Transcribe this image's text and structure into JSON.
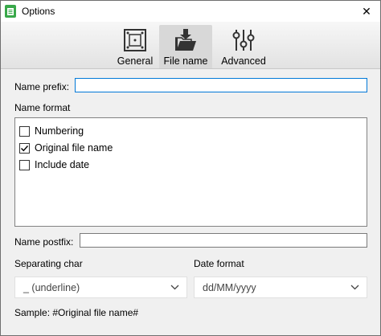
{
  "window": {
    "title": "Options",
    "close_glyph": "✕"
  },
  "tabs": [
    {
      "label": "General",
      "icon": "panel-icon",
      "active": false
    },
    {
      "label": "File name",
      "icon": "folder-download-icon",
      "active": true
    },
    {
      "label": "Advanced",
      "icon": "sliders-icon",
      "active": false
    }
  ],
  "name_prefix": {
    "label": "Name prefix:",
    "value": ""
  },
  "name_format": {
    "label": "Name format",
    "items": [
      {
        "label": "Numbering",
        "checked": false
      },
      {
        "label": "Original file name",
        "checked": true
      },
      {
        "label": "Include date",
        "checked": false
      }
    ]
  },
  "name_postfix": {
    "label": "Name postfix:",
    "value": ""
  },
  "separating_char": {
    "label": "Separating char",
    "value": "_ (underline)"
  },
  "date_format": {
    "label": "Date format",
    "value": "dd/MM/yyyy"
  },
  "sample": {
    "text": "Sample: #Original file name#"
  },
  "colors": {
    "accent": "#0078d7",
    "app_icon": "#39a84a",
    "active_tab": "#d8d8d8"
  }
}
